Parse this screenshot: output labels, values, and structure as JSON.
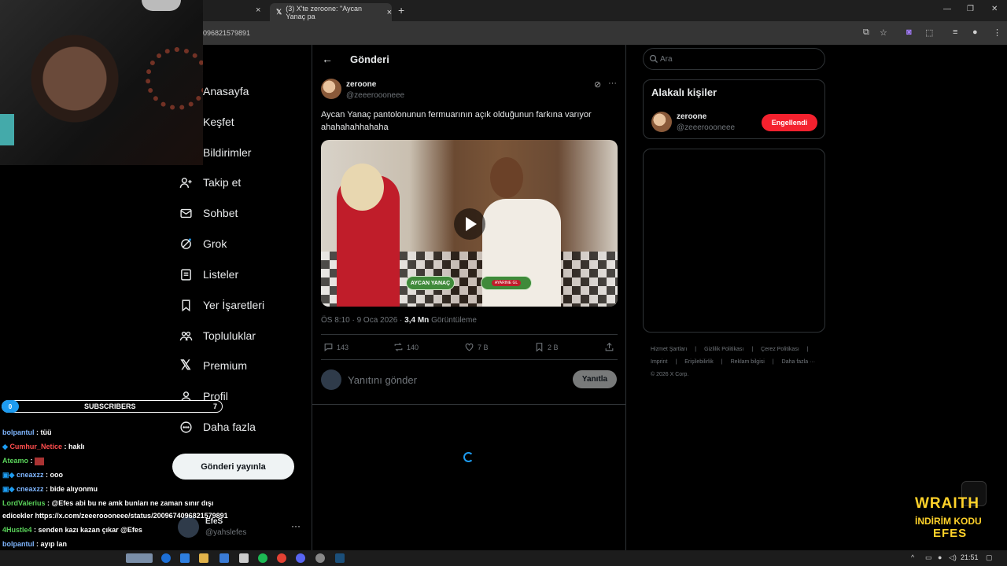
{
  "browser": {
    "tab_title": "(3) X'te zeroone: \"Aycan Yanaç pa",
    "url_fragment": "096821579891",
    "tab_close": "×",
    "new_tab": "+",
    "win_min": "—",
    "win_max": "❐",
    "win_close": "✕"
  },
  "nav": {
    "items": [
      {
        "label": "Anasayfa"
      },
      {
        "label": "Keşfet"
      },
      {
        "label": "Bildirimler"
      },
      {
        "label": "Takip et"
      },
      {
        "label": "Sohbet"
      },
      {
        "label": "Grok"
      },
      {
        "label": "Listeler"
      },
      {
        "label": "Yer İşaretleri"
      },
      {
        "label": "Topluluklar"
      },
      {
        "label": "Premium"
      },
      {
        "label": "Profil"
      },
      {
        "label": "Daha fazla"
      }
    ],
    "post_button": "Gönderi yayınla",
    "account": {
      "name": "EfeS",
      "handle": "@yahslefes",
      "more": "···"
    }
  },
  "main": {
    "header_title": "Gönderi",
    "back": "←",
    "tweet": {
      "name": "zeroone",
      "handle": "@zeeeroooneee",
      "more": "···",
      "text": "Aycan Yanaç pantolonunun fermuarının açık olduğunun farkına varıyor ahahahahhahaha",
      "video_label_left": "AYCAN YANAÇ",
      "video_label_right": "AYARINE GL",
      "time": "ÖS 8:10 · 9 Oca 2026 · ",
      "views": "3,4 Mn",
      "views_label": " Görüntüleme",
      "replies": "143",
      "reposts": "140",
      "likes": "7 B",
      "bookmarks": "2 B"
    },
    "reply_placeholder": "Yanıtını gönder",
    "reply_button": "Yanıtla"
  },
  "sidebar": {
    "search_placeholder": "Ara",
    "related_title": "Alakalı kişiler",
    "related": {
      "name": "zeroone",
      "handle": "@zeeeroooneee",
      "button": "Engellendi"
    },
    "footer": [
      "Hizmet Şartları",
      "|",
      "Gizlilik Politikası",
      "|",
      "Çerez Politikası",
      "|",
      "Imprint",
      "|",
      "Erişilebilirlik",
      "|",
      "Reklam bilgisi",
      "|",
      "Daha fazla ···",
      "© 2026 X Corp."
    ]
  },
  "overlay": {
    "subs_number": "0",
    "subs_label": "SUBSCRIBERS",
    "subs_count": "7",
    "chat": [
      {
        "user": "bolpantul",
        "msg": " : tüü",
        "color": "#7fb6ff"
      },
      {
        "user": "Cumhur_Netice",
        "msg": " : haklı",
        "color": "#ff4d4d"
      },
      {
        "user": "Ateamo",
        "msg": " : ",
        "color": "#5ad35a"
      },
      {
        "user": "cneaxzz",
        "msg": " : ooo",
        "color": "#7fb6ff"
      },
      {
        "user": "cneaxzz",
        "msg": " : bide alıyonmu",
        "color": "#7fb6ff"
      },
      {
        "user": "LordValerius",
        "msg": " : @Efes abi bu ne amk bunları ne zaman sınır dışı",
        "color": "#5ad35a"
      },
      {
        "user": "",
        "msg": "edicekler https://x.com/zeeeroooneee/status/2009674096821579891",
        "color": "#fff"
      },
      {
        "user": "4Hustle4",
        "msg": " : senden kazı kazan çıkar @Efes",
        "color": "#5ad35a"
      },
      {
        "user": "bolpantul",
        "msg": " : ayıp lan",
        "color": "#7fb6ff"
      }
    ],
    "brand_line1": "WRAITH",
    "brand_line2": "İNDİRİM KODU",
    "brand_line3": "EFES"
  },
  "taskbar": {
    "time": "21:51",
    "tray_expand": "^"
  }
}
